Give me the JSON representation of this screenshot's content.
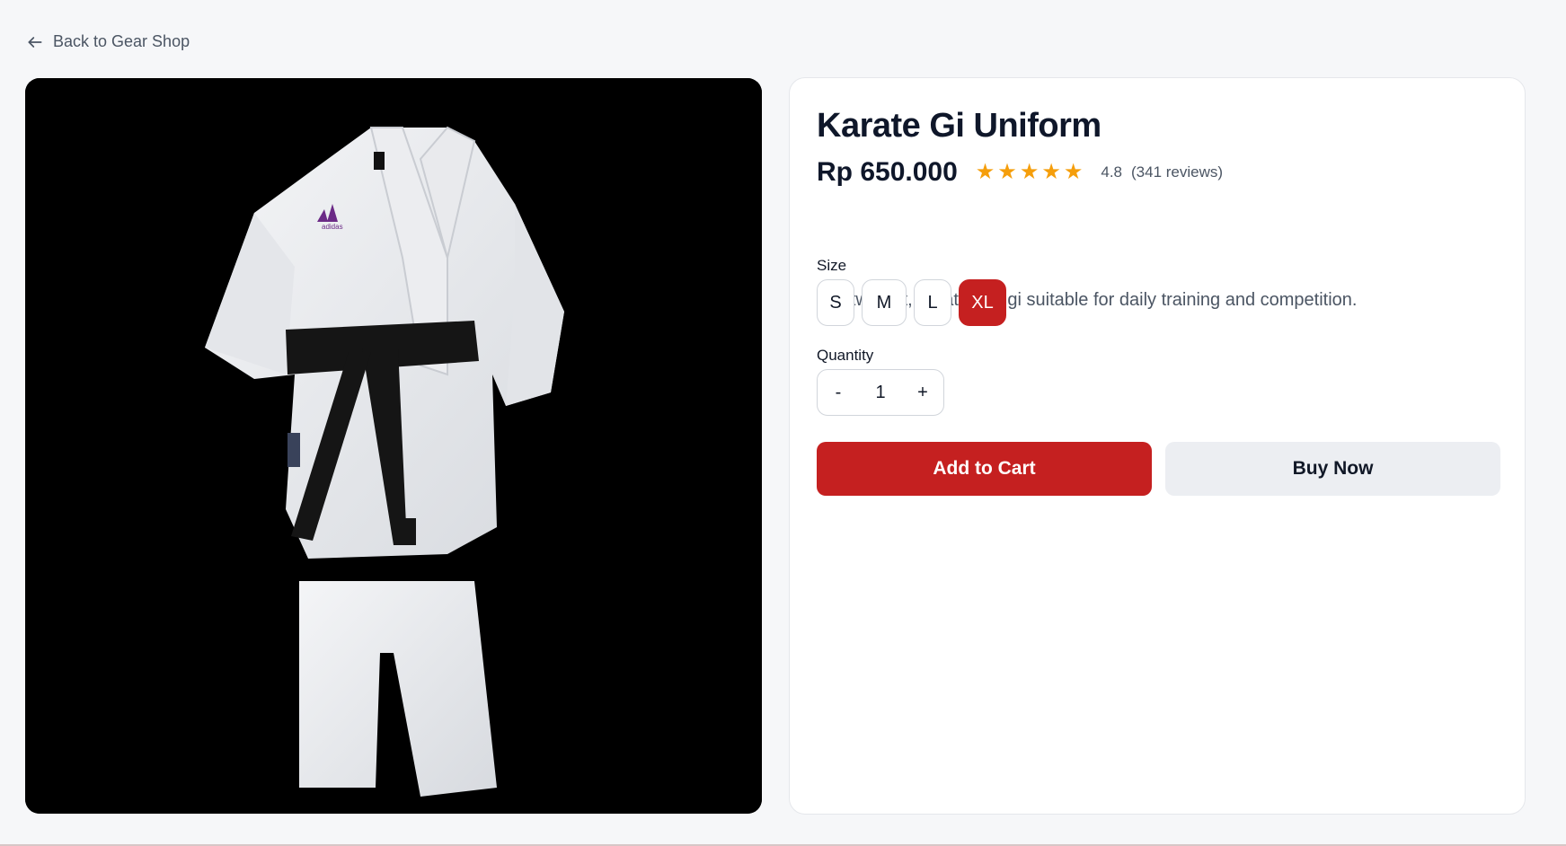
{
  "nav": {
    "back_label": "Back to Gear Shop"
  },
  "product": {
    "title": "Karate Gi Uniform",
    "price": "Rp 650.000",
    "rating_value": "4.8",
    "reviews": "(341 reviews)",
    "rating_stars": 5,
    "description": "Lightweight, breathable gi suitable for daily training and competition.",
    "image_brand_mark": "adidas"
  },
  "size": {
    "label": "Size",
    "options": [
      "S",
      "M",
      "L",
      "XL"
    ],
    "selected": "XL"
  },
  "quantity": {
    "label": "Quantity",
    "decrement": "-",
    "value": "1",
    "increment": "+"
  },
  "actions": {
    "add_to_cart": "Add to Cart",
    "buy_now": "Buy Now"
  },
  "colors": {
    "accent": "#c52020",
    "star": "#f59e0b",
    "secondary_button": "#eceef2"
  },
  "icons": {
    "back": "arrow-left-icon",
    "star": "star-icon"
  }
}
